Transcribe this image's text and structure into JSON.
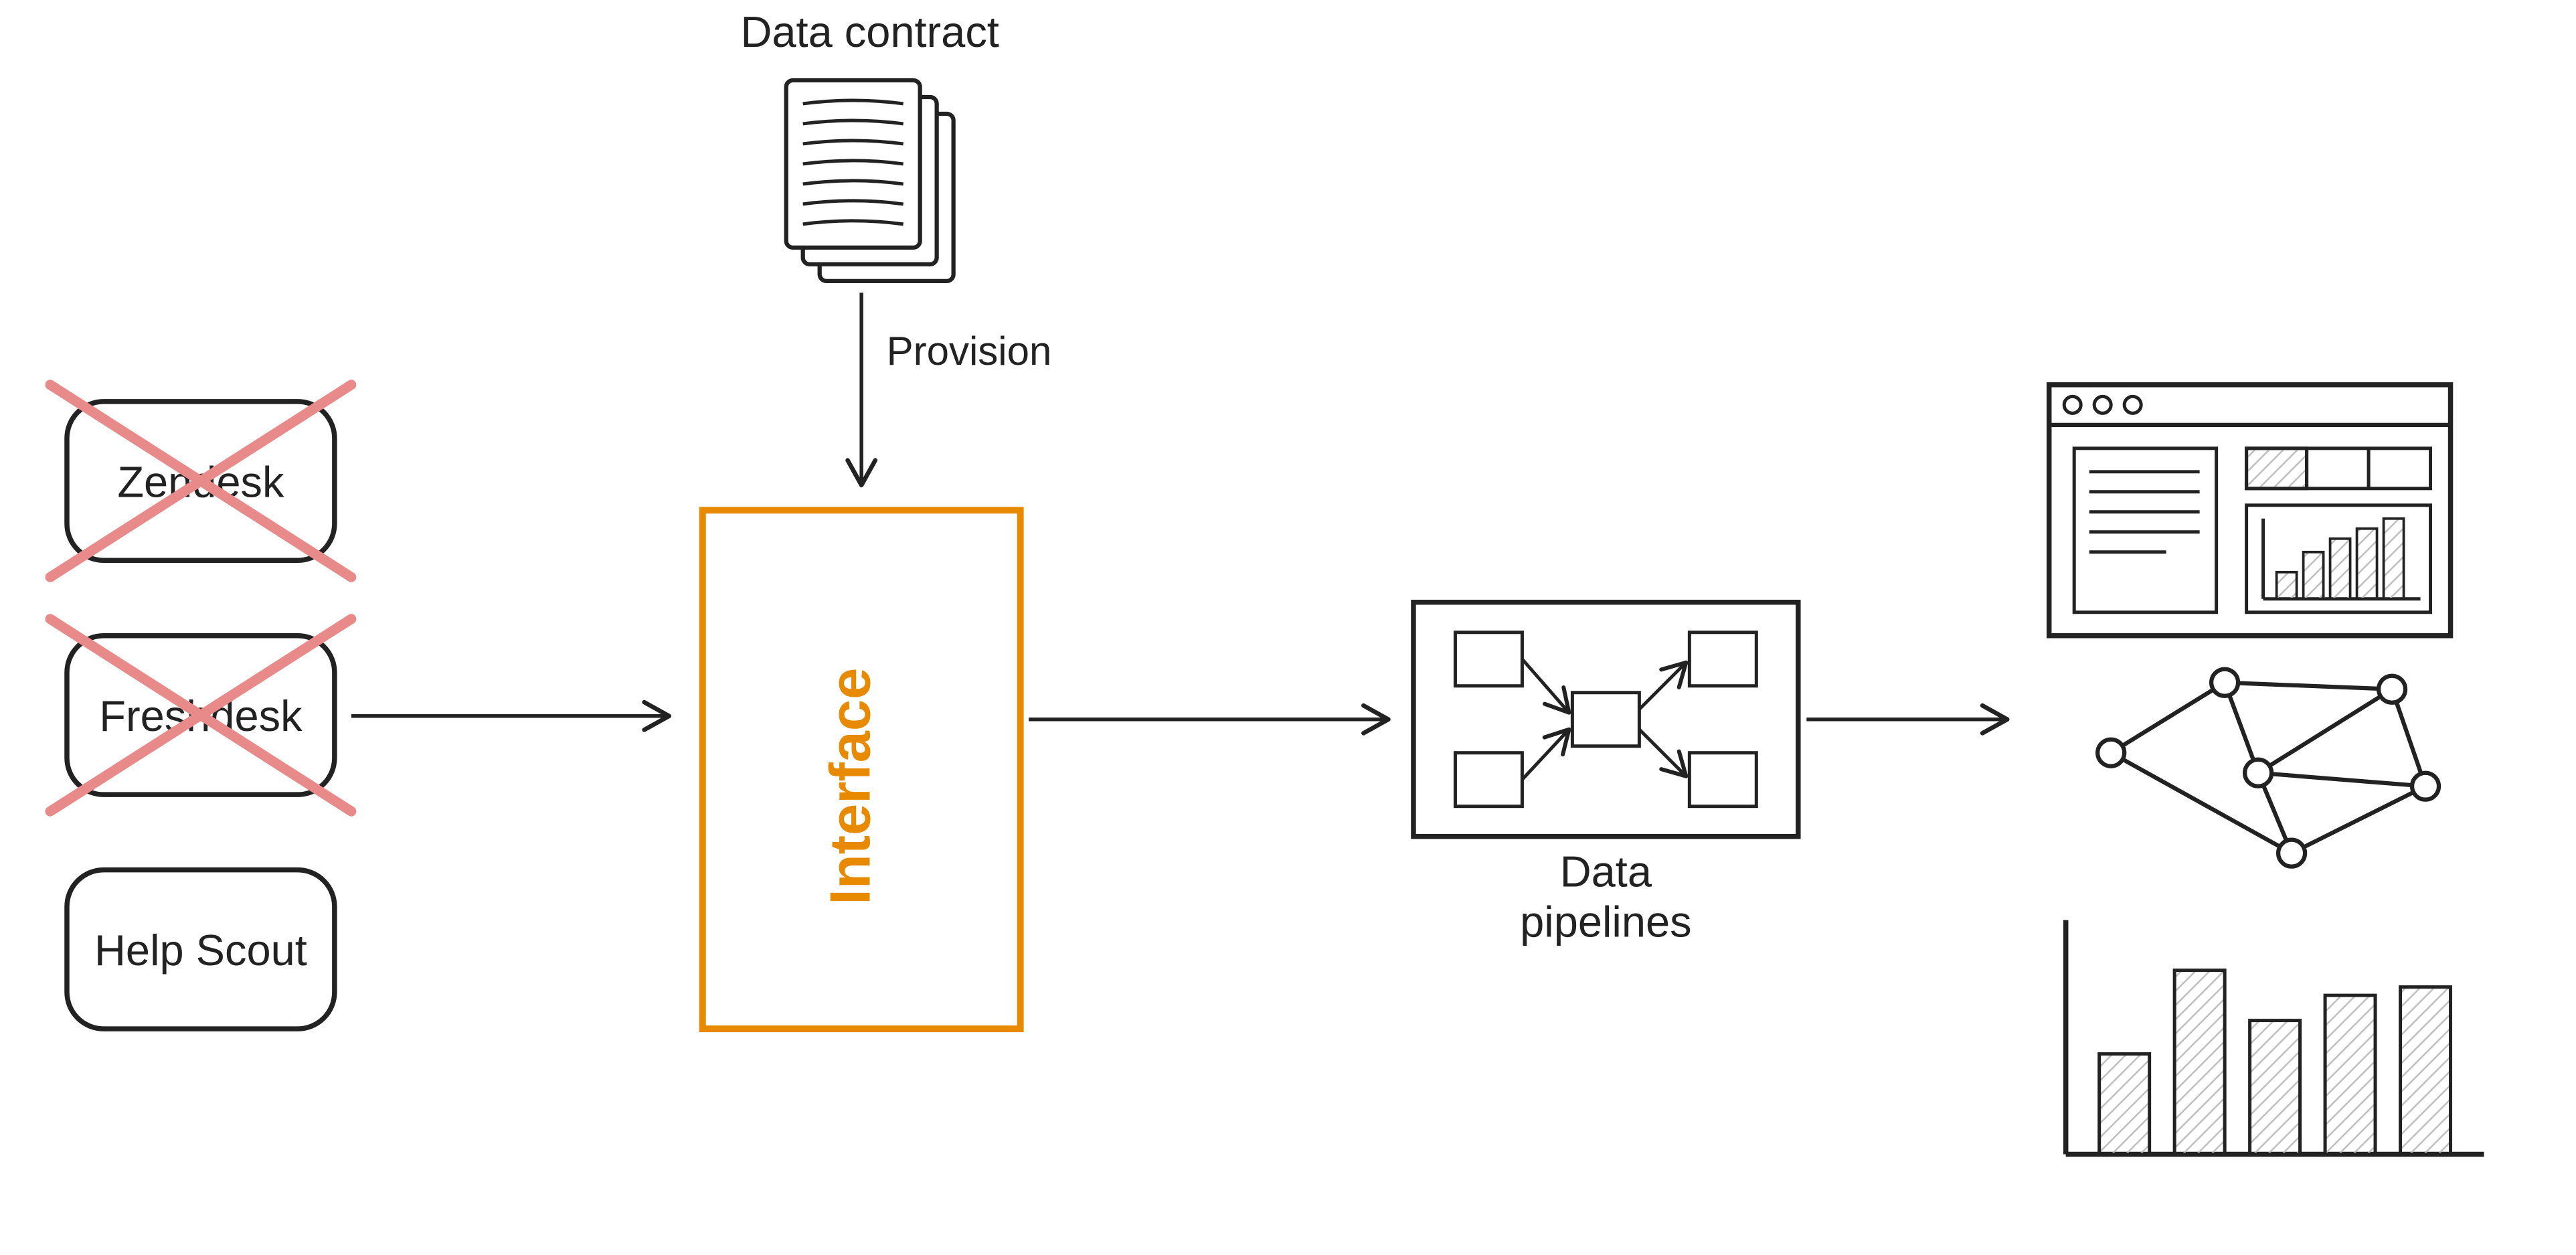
{
  "diagram": {
    "nodes": {
      "data_contract": {
        "label": "Data contract"
      },
      "provision_arrow": {
        "label": "Provision"
      },
      "sources": [
        {
          "label": "Zendesk",
          "crossed_out": true
        },
        {
          "label": "Freshdesk",
          "crossed_out": true
        },
        {
          "label": "Help Scout",
          "crossed_out": false
        }
      ],
      "interface": {
        "label": "Interface"
      },
      "data_pipelines": {
        "label_line1": "Data",
        "label_line2": "pipelines"
      }
    },
    "flow": [
      "sources → interface",
      "data_contract → (Provision) → interface",
      "interface → data_pipelines",
      "data_pipelines → outputs (dashboard, graph, bar chart)"
    ],
    "colors": {
      "stroke": "#222222",
      "cross": "#e88a8a",
      "accent": "#e78a00",
      "hatch": "#bfbfbf"
    },
    "outputs": [
      {
        "type": "dashboard-window"
      },
      {
        "type": "network-graph"
      },
      {
        "type": "bar-chart"
      }
    ]
  }
}
